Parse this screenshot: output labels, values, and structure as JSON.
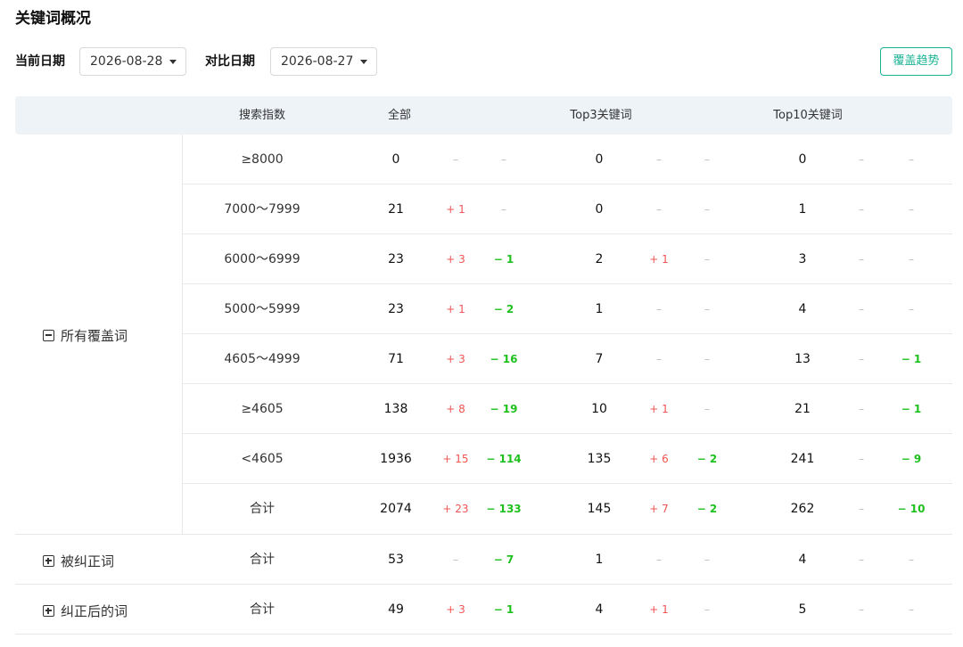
{
  "page": {
    "title": "关键词概况"
  },
  "filters": {
    "current_label": "当前日期",
    "current_value": "2026-08-28",
    "compare_label": "对比日期",
    "compare_value": "2026-08-27",
    "trend_button": "覆盖趋势"
  },
  "colors": {
    "accent": "#1ab394",
    "increase": "#f05454",
    "decrease": "#1ec11e",
    "header_bg": "#eef3f8"
  },
  "table": {
    "headers": [
      "搜索指数",
      "全部",
      "Top3关键词",
      "Top10关键词"
    ],
    "groups": [
      {
        "label": "所有覆盖词",
        "icon": "collapse-icon",
        "rows": [
          {
            "index": "≥8000",
            "all": [
              "0",
              "–",
              "–"
            ],
            "top3": [
              "0",
              "–",
              "–"
            ],
            "top10": [
              "0",
              "–",
              "–"
            ]
          },
          {
            "index": "7000～7999",
            "all": [
              "21",
              "+ 1",
              "–"
            ],
            "top3": [
              "0",
              "–",
              "–"
            ],
            "top10": [
              "1",
              "–",
              "–"
            ]
          },
          {
            "index": "6000～6999",
            "all": [
              "23",
              "+ 3",
              "− 1"
            ],
            "top3": [
              "2",
              "+ 1",
              "–"
            ],
            "top10": [
              "3",
              "–",
              "–"
            ]
          },
          {
            "index": "5000～5999",
            "all": [
              "23",
              "+ 1",
              "− 2"
            ],
            "top3": [
              "1",
              "–",
              "–"
            ],
            "top10": [
              "4",
              "–",
              "–"
            ]
          },
          {
            "index": "4605～4999",
            "all": [
              "71",
              "+ 3",
              "− 16"
            ],
            "top3": [
              "7",
              "–",
              "–"
            ],
            "top10": [
              "13",
              "–",
              "− 1"
            ]
          },
          {
            "index": "≥4605",
            "all": [
              "138",
              "+ 8",
              "− 19"
            ],
            "top3": [
              "10",
              "+ 1",
              "–"
            ],
            "top10": [
              "21",
              "–",
              "− 1"
            ]
          },
          {
            "index": "<4605",
            "all": [
              "1936",
              "+ 15",
              "− 114"
            ],
            "top3": [
              "135",
              "+ 6",
              "− 2"
            ],
            "top10": [
              "241",
              "–",
              "− 9"
            ]
          },
          {
            "index": "合计",
            "all": [
              "2074",
              "+ 23",
              "− 133"
            ],
            "top3": [
              "145",
              "+ 7",
              "− 2"
            ],
            "top10": [
              "262",
              "–",
              "− 10"
            ]
          }
        ]
      },
      {
        "label": "被纠正词",
        "icon": "expand-icon",
        "rows": [
          {
            "index": "合计",
            "all": [
              "53",
              "–",
              "− 7"
            ],
            "top3": [
              "1",
              "–",
              "–"
            ],
            "top10": [
              "4",
              "–",
              "–"
            ]
          }
        ]
      },
      {
        "label": "纠正后的词",
        "icon": "expand-icon",
        "rows": [
          {
            "index": "合计",
            "all": [
              "49",
              "+ 3",
              "− 1"
            ],
            "top3": [
              "4",
              "+ 1",
              "–"
            ],
            "top10": [
              "5",
              "–",
              "–"
            ]
          }
        ]
      }
    ]
  }
}
